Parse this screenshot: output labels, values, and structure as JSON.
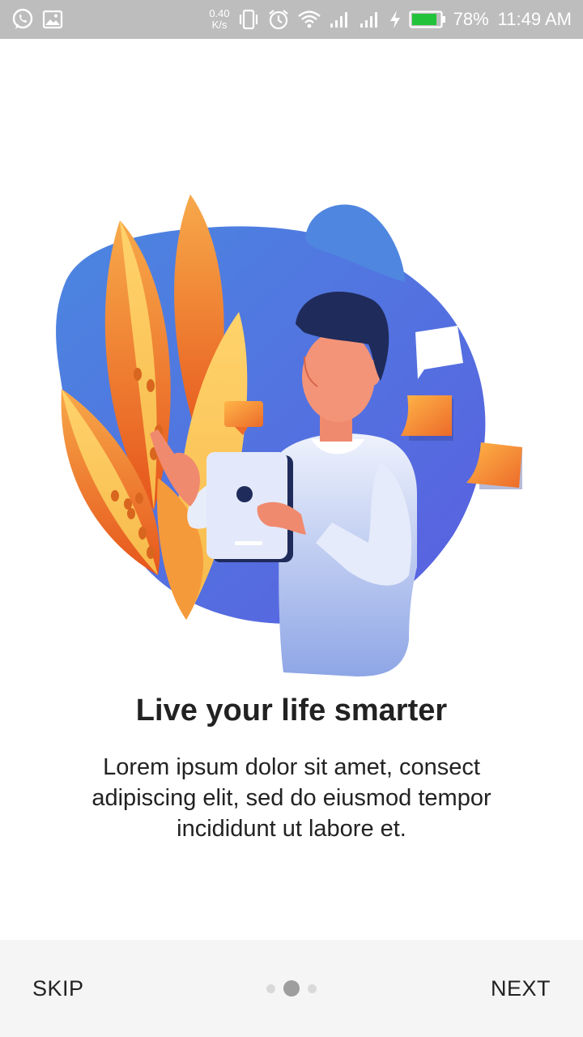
{
  "status_bar": {
    "net_speed_value": "0.40",
    "net_speed_unit": "K/s",
    "battery_percent": "78%",
    "time": "11:49 AM",
    "icons": [
      "whatsapp-icon",
      "image-icon",
      "vibrate-icon",
      "alarm-icon",
      "wifi-icon",
      "signal-icon",
      "signal-icon-2",
      "charging-icon",
      "battery-icon"
    ],
    "battery_color": "#22c33a"
  },
  "onboarding": {
    "title": "Live your life smarter",
    "description": "Lorem ipsum dolor sit amet, consect adipiscing elit, sed do eiusmod tempor incididunt ut labore et.",
    "current_page": 2,
    "total_pages": 3
  },
  "navigation": {
    "skip_label": "SKIP",
    "next_label": "NEXT"
  },
  "colors": {
    "accent_blue": "#4f7fe0",
    "accent_orange": "#f08a2c",
    "text": "#222222",
    "bottom_bar": "#f5f5f5"
  }
}
